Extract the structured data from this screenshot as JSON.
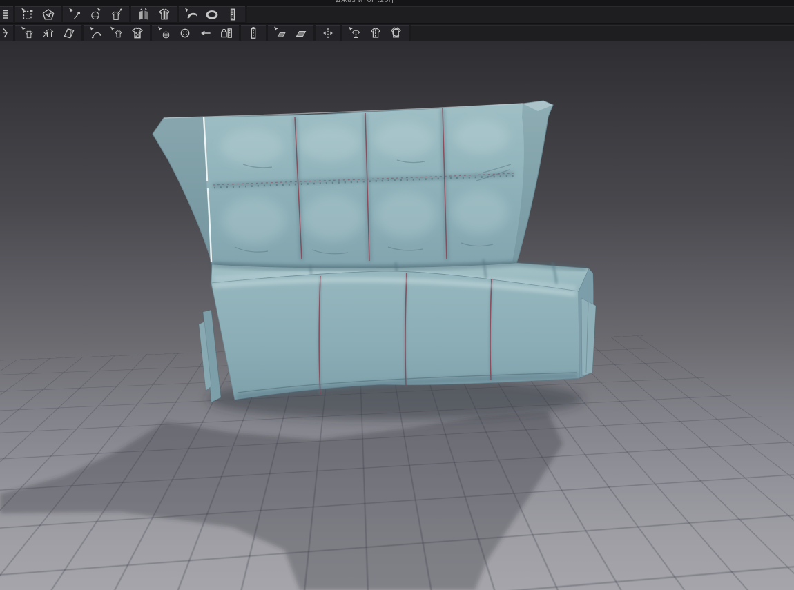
{
  "window": {
    "title": "Джаз итог .zprj"
  },
  "toolbar_row1": {
    "tools": [
      "pattern-list (clipped at screen edge)",
      "transform-pattern",
      "edit-pattern",
      "select-pin",
      "pin",
      "tack-garment",
      "fold-arrangement",
      "tack-on-avatar",
      "tape-measure",
      "circumference-tape",
      "ruler"
    ]
  },
  "toolbar_row2": {
    "tools": [
      "brush (clipped at screen edge)",
      "select-garment",
      "remove-garment",
      "fold-garment",
      "edit-sewing",
      "select-texture",
      "edit-texture",
      "select-button",
      "attach-button",
      "attach-buttonhole",
      "lock-zipper",
      "zipper",
      "select-plane",
      "mirror-plane",
      "symmetric-arrange",
      "edit-stitch",
      "stitch",
      "rotate-texture"
    ]
  },
  "viewport": {
    "object": "upholstered sofa-bed 3D garment model, quilted in 4x2 panels",
    "fabric_color": "#8fb1b9",
    "stitch_color": "#8c4050",
    "seam_highlight_color": "#ecf3f4",
    "background_top": "#2e2e32",
    "background_bottom": "#a5a5ab",
    "floor": "perspective grid plane",
    "shadow": "soft cast shadow on floor"
  }
}
